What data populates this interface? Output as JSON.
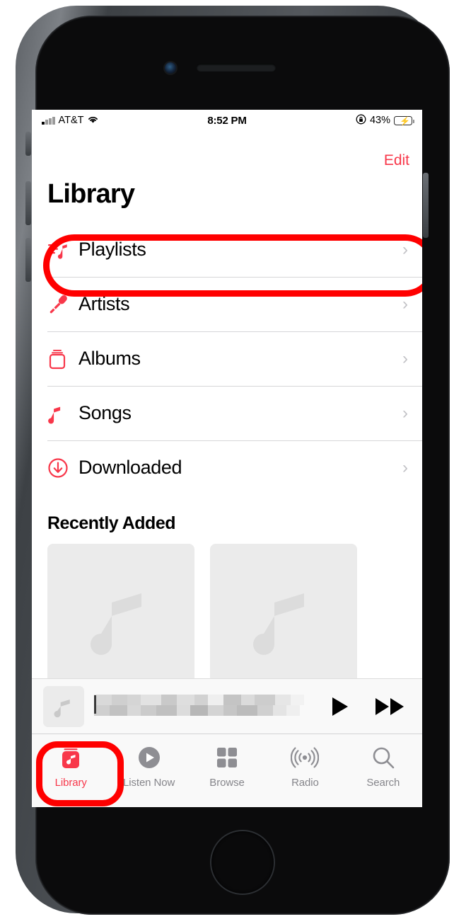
{
  "device": {
    "model_hint": "iphone-home-button"
  },
  "status_bar": {
    "carrier": "AT&T",
    "signal_icon": "cellular-bars-icon",
    "wifi_icon": "wifi-icon",
    "time": "8:52 PM",
    "rotation_lock_icon": "rotation-lock-icon",
    "battery_percent": "43%",
    "battery_level": 43,
    "battery_charging": true,
    "battery_color": "#35c759"
  },
  "nav": {
    "edit_label": "Edit",
    "accent_color": "#f8374a"
  },
  "header": {
    "title": "Library"
  },
  "library": {
    "rows": [
      {
        "label": "Playlists",
        "icon": "playlist-icon",
        "chevron": "›"
      },
      {
        "label": "Artists",
        "icon": "microphone-icon",
        "chevron": "›"
      },
      {
        "label": "Albums",
        "icon": "albums-icon",
        "chevron": "›"
      },
      {
        "label": "Songs",
        "icon": "music-note-icon",
        "chevron": "›"
      },
      {
        "label": "Downloaded",
        "icon": "download-circle-icon",
        "chevron": "›"
      }
    ]
  },
  "recently_added": {
    "header": "Recently Added",
    "tiles": [
      {
        "placeholder_icon": "music-note-placeholder-icon"
      },
      {
        "placeholder_icon": "music-note-placeholder-icon"
      }
    ]
  },
  "mini_player": {
    "artwork_icon": "music-note-artwork-icon",
    "track_title": "",
    "track_title_state": "blurred",
    "play_icon": "play-icon",
    "forward_icon": "fast-forward-icon"
  },
  "tab_bar": {
    "active": "Library",
    "tabs": [
      {
        "label": "Library",
        "icon": "music-library-icon",
        "active": true
      },
      {
        "label": "Listen Now",
        "icon": "play-circle-icon",
        "active": false
      },
      {
        "label": "Browse",
        "icon": "grid-icon",
        "active": false
      },
      {
        "label": "Radio",
        "icon": "broadcast-icon",
        "active": false
      },
      {
        "label": "Search",
        "icon": "search-icon",
        "active": false
      }
    ]
  },
  "annotations": {
    "color": "#ff0000",
    "targets": [
      "Playlists",
      "Library"
    ]
  }
}
